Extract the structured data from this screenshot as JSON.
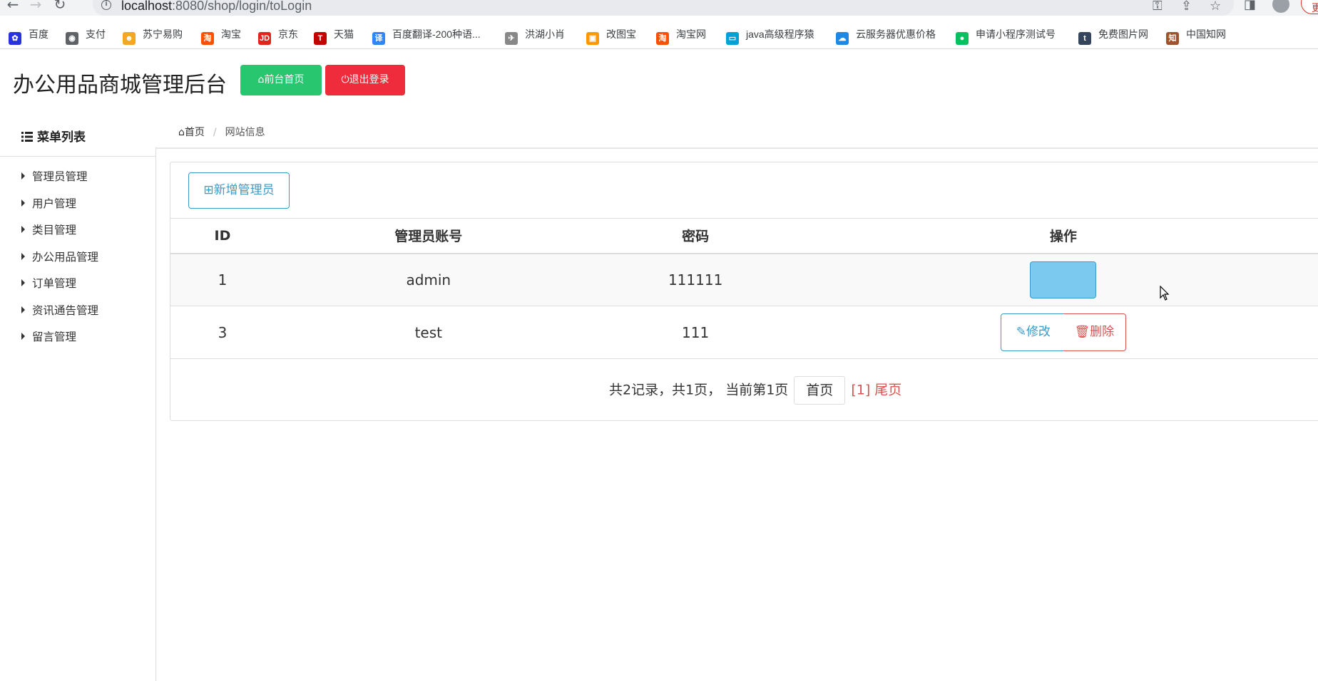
{
  "browser": {
    "url_host": "localhost",
    "url_rest": ":8080/shop/login/toLogin",
    "bookmarks": [
      {
        "label": "百度",
        "icon": "baidu-paw-icon",
        "color": "#2932e1"
      },
      {
        "label": "支付",
        "icon": "globe-icon",
        "color": "#5f6368"
      },
      {
        "label": "苏宁易购",
        "icon": "suning-lion-icon",
        "color": "#f5a623"
      },
      {
        "label": "淘宝",
        "icon": "taobao-icon",
        "color": "#ff5000"
      },
      {
        "label": "京东",
        "icon": "jd-icon",
        "color": "#e1251b"
      },
      {
        "label": "天猫",
        "icon": "tmall-icon",
        "color": "#c40000"
      },
      {
        "label": "百度翻译-200种语...",
        "icon": "translate-icon",
        "color": "#2f86f6"
      },
      {
        "label": "洪湖小肖",
        "icon": "bird-icon",
        "color": "#888888"
      },
      {
        "label": "改图宝",
        "icon": "gaitubao-icon",
        "color": "#ff9800"
      },
      {
        "label": "淘宝网",
        "icon": "taobao-icon",
        "color": "#ff5000"
      },
      {
        "label": "java高级程序猿",
        "icon": "bilibili-icon",
        "color": "#00a1d6"
      },
      {
        "label": "云服务器优惠价格",
        "icon": "cloud-icon",
        "color": "#1e88e5"
      },
      {
        "label": "申请小程序测试号",
        "icon": "wechat-icon",
        "color": "#07c160"
      },
      {
        "label": "免费图片网",
        "icon": "tumblr-icon",
        "color": "#35465c"
      },
      {
        "label": "中国知网",
        "icon": "cnki-icon",
        "color": "#a0522d"
      }
    ]
  },
  "header": {
    "title": "办公用品商城管理后台",
    "home_button": "前台首页",
    "logout_button": "退出登录"
  },
  "sidebar": {
    "title": "菜单列表",
    "items": [
      {
        "label": "管理员管理"
      },
      {
        "label": "用户管理"
      },
      {
        "label": "类目管理"
      },
      {
        "label": "办公用品管理"
      },
      {
        "label": "订单管理"
      },
      {
        "label": "资讯通告管理"
      },
      {
        "label": "留言管理"
      }
    ]
  },
  "breadcrumb": {
    "home": "首页",
    "current": "网站信息"
  },
  "main": {
    "add_button": "新增管理员",
    "table": {
      "headers": [
        "ID",
        "管理员账号",
        "密码",
        "操作"
      ],
      "rows": [
        {
          "id": "1",
          "account": "admin",
          "password": "111111"
        },
        {
          "id": "3",
          "account": "test",
          "password": "111"
        }
      ],
      "edit_label": "修改",
      "delete_label": "删除"
    },
    "pager": {
      "summary": "共2记录，共1页， 当前第1页",
      "first": "首页",
      "current": "[1]",
      "last": "尾页"
    }
  },
  "colors": {
    "success": "#28c76f",
    "danger": "#ee2c3b",
    "info": "#3a9bc9"
  }
}
